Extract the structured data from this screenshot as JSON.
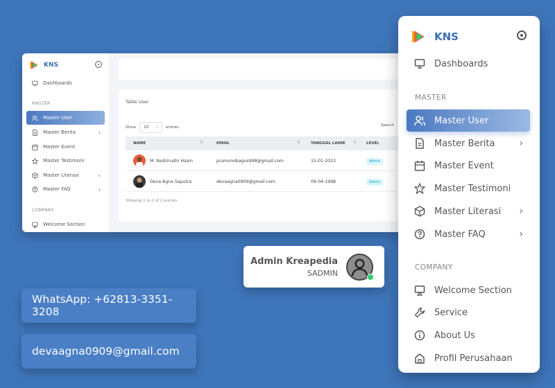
{
  "brand": {
    "name": "KNS"
  },
  "mini": {
    "nav": {
      "dashboards": "Dashboards",
      "master_section": "MASTER",
      "company_section": "COMPANY",
      "items": [
        "Master User",
        "Master Berita",
        "Master Event",
        "Master Testimoni",
        "Master Literasi",
        "Master FAQ"
      ],
      "welcome": "Welcome Section"
    },
    "table": {
      "title": "Table User",
      "show_label": "Show",
      "entries_value": "10",
      "entries_label": "entries",
      "search_label": "Search",
      "columns": [
        "NAME",
        "EMAIL",
        "TANGGAL LAHIR",
        "LEVEL"
      ],
      "rows": [
        {
          "name": "M. Nashirudin Hsain",
          "email": "pramonobagus998@gmail.com",
          "date": "15-01-2023",
          "level": "Admin"
        },
        {
          "name": "Deva Agna Saputra",
          "email": "devaagna0909@gmail.com",
          "date": "09-04-1998",
          "level": "Admin"
        }
      ],
      "footer": "Showing 1 to 2 of 2 entries"
    }
  },
  "sidebar": {
    "dashboards": "Dashboards",
    "master_section": "MASTER",
    "company_section": "COMPANY",
    "items": [
      "Master User",
      "Master Berita",
      "Master Event",
      "Master Testimoni",
      "Master Literasi",
      "Master FAQ"
    ],
    "company_items": [
      "Welcome Section",
      "Service",
      "About Us",
      "Profil Perusahaan"
    ]
  },
  "admin": {
    "name": "Admin Kreapedia",
    "role": "SADMIN"
  },
  "contact": {
    "whatsapp": "WhatsApp: +62813-3351-3208",
    "email": "devaagna0909@gmail.com"
  },
  "colors": {
    "background": "#3f76bb",
    "accent": "#4a79c0",
    "badge": "#1aa6c3",
    "online": "#2ecc71"
  }
}
